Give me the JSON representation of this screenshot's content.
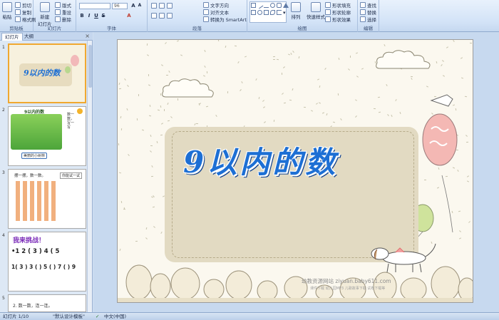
{
  "ribbon": {
    "clipboard": {
      "paste": "粘贴",
      "cut": "剪切",
      "copy": "复制",
      "format_painter": "格式刷",
      "label": "剪贴板"
    },
    "slides": {
      "new_slide": "新建",
      "new_slide2": "幻灯片",
      "layout": "版式",
      "reset": "重设",
      "delete": "删除",
      "label": "幻灯片"
    },
    "font": {
      "size": "96",
      "label": "字体"
    },
    "paragraph": {
      "text_direction": "文字方向",
      "align_text": "对齐文本",
      "smartart": "转换为 SmartArt",
      "label": "段落"
    },
    "drawing": {
      "arrange": "排列",
      "quick_styles": "快速样式",
      "shape_fill": "形状填充",
      "shape_outline": "形状轮廓",
      "shape_effects": "形状效果",
      "label": "绘图"
    },
    "editing": {
      "find": "查找",
      "replace": "替换",
      "select": "选择",
      "label": "编辑"
    }
  },
  "pane": {
    "tab_slides": "幻灯片",
    "tab_outline": "大纲",
    "thumbs": [
      {
        "num": "1",
        "title": "9以内的数"
      },
      {
        "num": "2",
        "title": "9以内的数",
        "side": "数一数，写一写",
        "caption": "美丽的小树林"
      },
      {
        "num": "3",
        "title": "摆一摆，数一数。",
        "caption": "你能试一试"
      },
      {
        "num": "4",
        "title": "我来挑战！",
        "line1": "•1 2 (  3  )  4 ( 5 ",
        "line2": "1( 3 ) 3 ( ) 5 ( ) 7 ( ) 9"
      },
      {
        "num": "5",
        "title": "2. 数一数，连一连。"
      }
    ]
  },
  "slide": {
    "title": "9以内的数",
    "watermark": "幼教资源网站  ziyuan.baby611.com",
    "watermark_sub": "课件下载    幼儿园MP3    儿歌故事下载    试卷下载等"
  },
  "status": {
    "slide_pos": "幻灯片 1/10",
    "theme": "\"默认设计模板\"",
    "language": "中文(中国)"
  },
  "colors": {
    "accent": "#1d6fd4",
    "ribbon": "#d3e3f7",
    "slide_bg": "#fbf8ef",
    "panel": "#e2dac2",
    "selected": "#f0a830"
  }
}
